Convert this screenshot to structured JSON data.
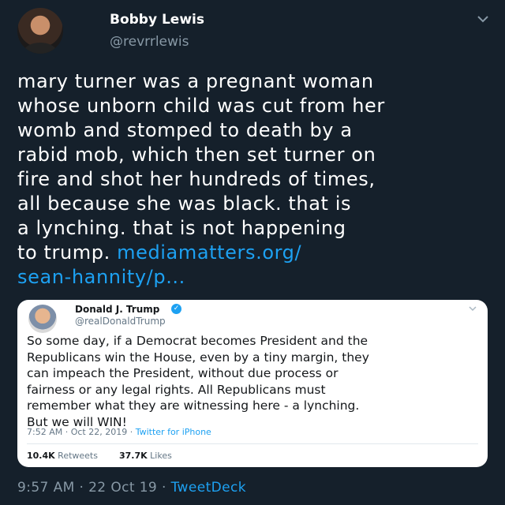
{
  "tweet": {
    "author_name": "Bobby Lewis",
    "author_handle": "@revrrlewis",
    "text": "mary turner was a pregnant woman\nwhose unborn child was cut from her\nwomb and stomped to death by a\nrabid mob, which then set turner on\nfire and shot her hundreds of times,\nall because she was black. that is\na lynching. that is not happening\nto trump. ",
    "link_text": "mediamatters.org/\nsean-hannity/p...",
    "timestamp": "9:57 AM · 22 Oct 19 · ",
    "source": "TweetDeck",
    "icons": {
      "avatar": "profile-photo",
      "menu": "chevron-down-icon"
    }
  },
  "quoted": {
    "author_name": "Donald J. Trump",
    "author_handle": "@realDonaldTrump",
    "verified_glyph": "✓",
    "text": "So some day, if a Democrat becomes President and the\nRepublicans win the House, even by a tiny margin, they\ncan impeach the President, without due process or\nfairness or any legal rights. All Republicans must\nremember what they are witnessing here - a lynching.\nBut we will WIN!",
    "timestamp": "7:52 AM · Oct 22, 2019 · ",
    "source": "Twitter for iPhone",
    "retweets_count": "10.4K",
    "retweets_label": "Retweets",
    "likes_count": "37.7K",
    "likes_label": "Likes"
  },
  "colors": {
    "background": "#15202b",
    "link": "#1da1f2",
    "secondary_text": "#8899a6",
    "card_background": "#ffffff"
  }
}
